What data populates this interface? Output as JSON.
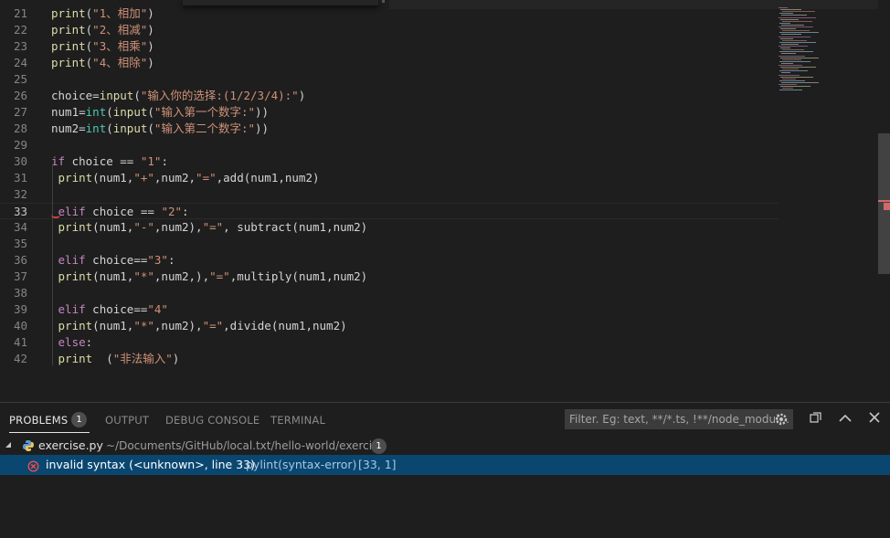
{
  "editor": {
    "lines": [
      {
        "n": "21",
        "tokens": [
          {
            "t": "print",
            "c": "fn"
          },
          {
            "t": "(",
            "c": "op"
          },
          {
            "t": "\"1、相加\"",
            "c": "str"
          },
          {
            "t": ")",
            "c": "op"
          }
        ]
      },
      {
        "n": "22",
        "tokens": [
          {
            "t": "print",
            "c": "fn"
          },
          {
            "t": "(",
            "c": "op"
          },
          {
            "t": "\"2、相减\"",
            "c": "str"
          },
          {
            "t": ")",
            "c": "op"
          }
        ]
      },
      {
        "n": "23",
        "tokens": [
          {
            "t": "print",
            "c": "fn"
          },
          {
            "t": "(",
            "c": "op"
          },
          {
            "t": "\"3、相乘\"",
            "c": "str"
          },
          {
            "t": ")",
            "c": "op"
          }
        ]
      },
      {
        "n": "24",
        "tokens": [
          {
            "t": "print",
            "c": "fn"
          },
          {
            "t": "(",
            "c": "op"
          },
          {
            "t": "\"4、相除\"",
            "c": "str"
          },
          {
            "t": ")",
            "c": "op"
          }
        ]
      },
      {
        "n": "25",
        "tokens": []
      },
      {
        "n": "26",
        "tokens": [
          {
            "t": "choice=",
            "c": "op"
          },
          {
            "t": "input",
            "c": "fn"
          },
          {
            "t": "(",
            "c": "op"
          },
          {
            "t": "\"输入你的选择:(1/2/3/4):\"",
            "c": "str"
          },
          {
            "t": ")",
            "c": "op"
          }
        ]
      },
      {
        "n": "27",
        "tokens": [
          {
            "t": "num1=",
            "c": "op"
          },
          {
            "t": "int",
            "c": "bi"
          },
          {
            "t": "(",
            "c": "op"
          },
          {
            "t": "input",
            "c": "fn"
          },
          {
            "t": "(",
            "c": "op"
          },
          {
            "t": "\"输入第一个数字:\"",
            "c": "str"
          },
          {
            "t": "))",
            "c": "op"
          }
        ]
      },
      {
        "n": "28",
        "tokens": [
          {
            "t": "num2=",
            "c": "op"
          },
          {
            "t": "int",
            "c": "bi"
          },
          {
            "t": "(",
            "c": "op"
          },
          {
            "t": "input",
            "c": "fn"
          },
          {
            "t": "(",
            "c": "op"
          },
          {
            "t": "\"输入第二个数字:\"",
            "c": "str"
          },
          {
            "t": "))",
            "c": "op"
          }
        ]
      },
      {
        "n": "29",
        "tokens": []
      },
      {
        "n": "30",
        "tokens": [
          {
            "t": "if",
            "c": "kw"
          },
          {
            "t": " choice == ",
            "c": "op"
          },
          {
            "t": "\"1\"",
            "c": "str"
          },
          {
            "t": ":",
            "c": "op"
          }
        ]
      },
      {
        "n": "31",
        "tokens": [
          {
            "t": " print",
            "c": "fn"
          },
          {
            "t": "(num1,",
            "c": "op"
          },
          {
            "t": "\"+\"",
            "c": "str"
          },
          {
            "t": ",num2,",
            "c": "op"
          },
          {
            "t": "\"=\"",
            "c": "str"
          },
          {
            "t": ",add(num1,num2)",
            "c": "op"
          }
        ]
      },
      {
        "n": "32",
        "tokens": []
      },
      {
        "n": "33",
        "tokens": [
          {
            "t": " elif",
            "c": "kw"
          },
          {
            "t": " choice == ",
            "c": "op"
          },
          {
            "t": "\"2\"",
            "c": "str"
          },
          {
            "t": ":",
            "c": "op"
          }
        ],
        "current": true
      },
      {
        "n": "34",
        "tokens": [
          {
            "t": " print",
            "c": "fn"
          },
          {
            "t": "(num1,",
            "c": "op"
          },
          {
            "t": "\"-\"",
            "c": "str"
          },
          {
            "t": ",num2),",
            "c": "op"
          },
          {
            "t": "\"=\"",
            "c": "str"
          },
          {
            "t": ", subtract(num1,num2)",
            "c": "op"
          }
        ]
      },
      {
        "n": "35",
        "tokens": []
      },
      {
        "n": "36",
        "tokens": [
          {
            "t": " elif",
            "c": "kw"
          },
          {
            "t": " choice==",
            "c": "op"
          },
          {
            "t": "\"3\"",
            "c": "str"
          },
          {
            "t": ":",
            "c": "op"
          }
        ]
      },
      {
        "n": "37",
        "tokens": [
          {
            "t": " print",
            "c": "fn"
          },
          {
            "t": "(num1,",
            "c": "op"
          },
          {
            "t": "\"*\"",
            "c": "str"
          },
          {
            "t": ",num2,),",
            "c": "op"
          },
          {
            "t": "\"=\"",
            "c": "str"
          },
          {
            "t": ",multiply(num1,num2)",
            "c": "op"
          }
        ]
      },
      {
        "n": "38",
        "tokens": []
      },
      {
        "n": "39",
        "tokens": [
          {
            "t": " elif",
            "c": "kw"
          },
          {
            "t": " choice==",
            "c": "op"
          },
          {
            "t": "\"4\"",
            "c": "str"
          }
        ]
      },
      {
        "n": "40",
        "tokens": [
          {
            "t": " print",
            "c": "fn"
          },
          {
            "t": "(num1,",
            "c": "op"
          },
          {
            "t": "\"*\"",
            "c": "str"
          },
          {
            "t": ",num2),",
            "c": "op"
          },
          {
            "t": "\"=\"",
            "c": "str"
          },
          {
            "t": ",divide(num1,num2)",
            "c": "op"
          }
        ]
      },
      {
        "n": "41",
        "tokens": [
          {
            "t": " else",
            "c": "kw"
          },
          {
            "t": ":",
            "c": "op"
          }
        ]
      },
      {
        "n": "42",
        "tokens": [
          {
            "t": " print",
            "c": "fn"
          },
          {
            "t": "  (",
            "c": "op"
          },
          {
            "t": "\"非法输入\"",
            "c": "str"
          },
          {
            "t": ")",
            "c": "op"
          }
        ]
      }
    ]
  },
  "panel": {
    "tabs": {
      "problems": "PROBLEMS",
      "problems_count": "1",
      "output": "OUTPUT",
      "debug_console": "DEBUG CONSOLE",
      "terminal": "TERMINAL"
    },
    "filter_placeholder": "Filter. Eg: text, **/*.ts, !**/node_modul...",
    "file": {
      "name": "exercise.py",
      "path": "~/Documents/GitHub/local.txt/hello-world/exercise",
      "count": "1"
    },
    "problem": {
      "message": "invalid syntax (<unknown>, line 33)",
      "source": "pylint(syntax-error)",
      "position": "[33, 1]"
    }
  },
  "icons": {
    "filter_settings": "gear-icon",
    "collapse_all": "collapse-all-icon",
    "maximize": "chevron-up-icon",
    "close": "close-icon",
    "python_file": "python-icon",
    "error": "error-icon",
    "twistie": "chevron-down-icon"
  },
  "colors": {
    "keyword": "#c586c0",
    "function": "#dcdcaa",
    "builtin": "#4ec9b0",
    "string": "#ce9178",
    "selection": "#094771",
    "error": "#f14c4c"
  }
}
